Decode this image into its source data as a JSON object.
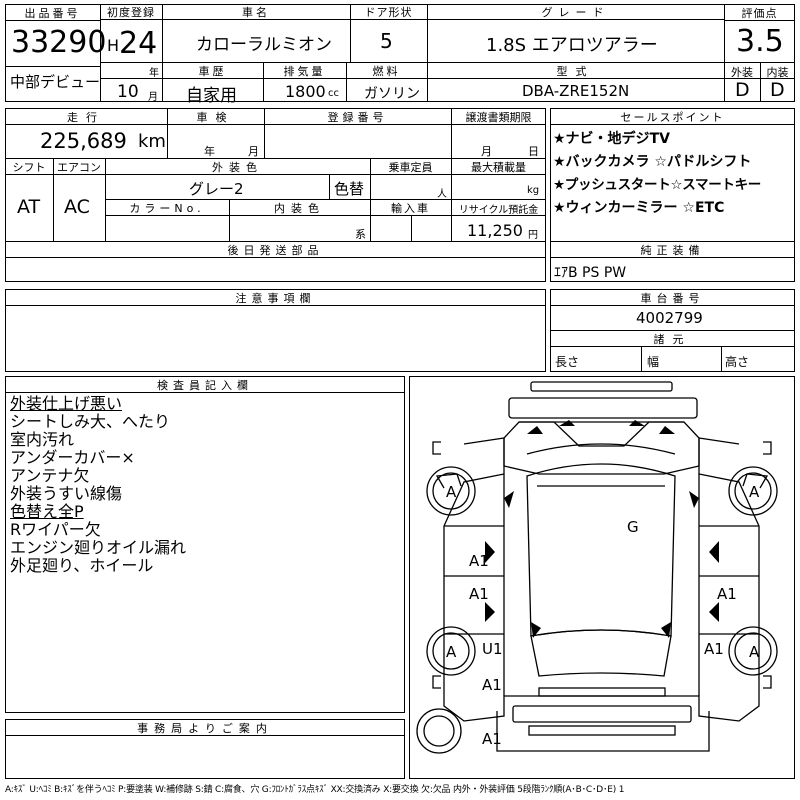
{
  "header": {
    "lot_no": {
      "label": "出品番号",
      "value": "33290",
      "sub": "中部デビュー"
    },
    "first_reg": {
      "label": "初度登録",
      "era": "H",
      "year": "24",
      "year_unit": "年",
      "month": "10",
      "month_unit": "月"
    },
    "car_name": {
      "label": "車名",
      "value": "カローラルミオン"
    },
    "doors": {
      "label": "ドア形状",
      "value": "5"
    },
    "grade": {
      "label": "グレード",
      "value": "1.8S エアロツアラー"
    },
    "score": {
      "label": "評価点",
      "value": "3.5",
      "ext_label": "外装",
      "int_label": "内装",
      "ext": "D",
      "int": "D"
    },
    "history": {
      "label": "車歴",
      "value": "自家用"
    },
    "displacement": {
      "label": "排気量",
      "value": "1800",
      "unit": "cc"
    },
    "fuel": {
      "label": "燃料",
      "value": "ガソリン"
    },
    "model": {
      "label": "型式",
      "value": "DBA-ZRE152N"
    }
  },
  "info": {
    "mileage": {
      "label": "走行",
      "value": "225,689",
      "unit": "km"
    },
    "shaken": {
      "label": "車検",
      "year_unit": "年",
      "month_unit": "月"
    },
    "reg_no": {
      "label": "登録番号"
    },
    "transfer": {
      "label": "譲渡書類期限",
      "month_unit": "月",
      "day_unit": "日"
    },
    "shift": {
      "label": "シフト",
      "value": "AT"
    },
    "aircon": {
      "label": "エアコン",
      "value": "AC"
    },
    "ext_color": {
      "label": "外装色",
      "value": "グレー2",
      "repaint": "色替"
    },
    "capacity": {
      "label": "乗車定員",
      "unit": "人"
    },
    "max_load": {
      "label": "最大積載量",
      "unit": "kg"
    },
    "color_no": {
      "label": "カラーNo."
    },
    "int_color": {
      "label": "内装色",
      "unit": "系"
    },
    "import": {
      "label": "輸入車"
    },
    "recycle": {
      "label": "リサイクル預託金",
      "value": "11,250",
      "unit": "円"
    },
    "later_parts": {
      "label": "後日発送部品"
    }
  },
  "sales_points": {
    "label": "セールスポイント",
    "lines": [
      "★ナビ・地デジTV",
      "★バックカメラ ☆パドルシフト",
      "★プッシュスタート☆スマートキー",
      "★ウィンカーミラー ☆ETC"
    ]
  },
  "equipment": {
    "label": "純正装備",
    "value": "ｴｱB PS PW"
  },
  "notes": {
    "label": "注意事項欄"
  },
  "chassis": {
    "label": "車台番号",
    "value": "4002799",
    "dims_label": "諸元",
    "length": "長さ",
    "width": "幅",
    "height": "高さ"
  },
  "inspector": {
    "label": "検査員記入欄",
    "lines": [
      "外装仕上げ悪い",
      "シートしみ大、へたり",
      "室内汚れ",
      "アンダーカバー×",
      "アンテナ欠",
      "外装うすい線傷",
      "色替え全P",
      "Rワイパー欠",
      "エンジン廻りオイル漏れ",
      "外足廻り、ホイール"
    ]
  },
  "office": {
    "label": "事務局よりご案内"
  },
  "diagram": {
    "marks": {
      "wheel_fl": "A",
      "wheel_fr": "A",
      "wheel_rl": "A",
      "wheel_rr": "A",
      "roof": "G",
      "door_fl": "A1",
      "door_rl": "A1",
      "door_rr": "A1",
      "sill_l": "U1",
      "fender_rr": "A1",
      "quarter_l": "A1",
      "spare": "A1"
    }
  },
  "legend": "A:ｷｽﾞ U:ﾍｺﾐ B:ｷｽﾞを伴うﾍｺﾐ P:要塗装 W:補修跡 S:錆 C:腐食、穴 G:ﾌﾛﾝﾄｶﾞﾗｽ点ｷｽﾞ XX:交換済み X:要交換 欠:欠品 内外・外装評価 5段階ﾗﾝｸ順(A･B･C･D･E) 1"
}
